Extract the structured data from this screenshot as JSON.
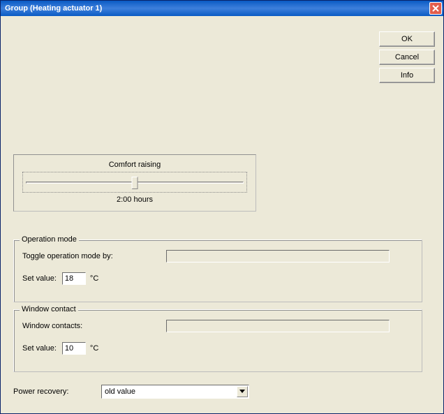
{
  "title": "Group (Heating actuator 1)",
  "buttons": {
    "ok": "OK",
    "cancel": "Cancel",
    "info": "Info"
  },
  "comfort": {
    "label": "Comfort raising",
    "value_text": "2:00 hours"
  },
  "operation_mode": {
    "legend": "Operation mode",
    "toggle_label": "Toggle operation mode by:",
    "toggle_value": "",
    "setvalue_label": "Set value:",
    "setvalue": "18",
    "unit": "°C"
  },
  "window_contact": {
    "legend": "Window contact",
    "contacts_label": "Window contacts:",
    "contacts_value": "",
    "setvalue_label": "Set value:",
    "setvalue": "10",
    "unit": "°C"
  },
  "power_recovery": {
    "label": "Power recovery:",
    "value": "old value"
  }
}
